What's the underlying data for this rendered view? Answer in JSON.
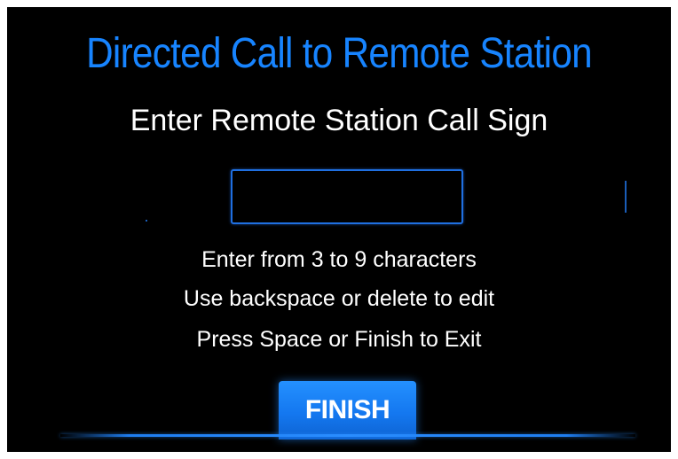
{
  "dialog": {
    "title": "Directed Call to Remote Station",
    "subtitle": "Enter Remote Station Call Sign",
    "callsign_value": "",
    "instructions": [
      "Enter from 3 to 9 characters",
      "Use backspace or delete to edit",
      "Press Space or Finish to Exit"
    ],
    "finish_label": "FINISH"
  },
  "colors": {
    "background": "#000000",
    "title": "#1784ff",
    "accent": "#1478f0",
    "text": "#ffffff"
  }
}
